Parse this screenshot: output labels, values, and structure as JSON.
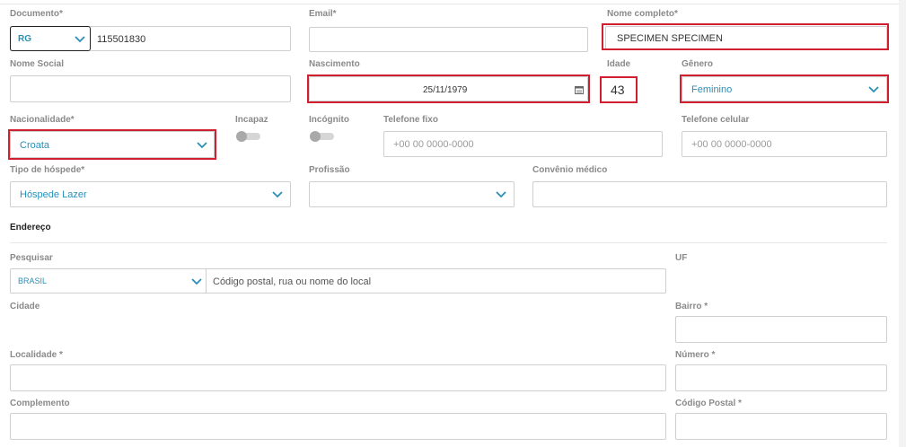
{
  "colors": {
    "accent": "#2a8fb6",
    "highlight": "#d01f2f",
    "border": "#cfcfcf",
    "label": "#8a8a8a"
  },
  "documento": {
    "label": "Documento*",
    "type": "RG",
    "number": "115501830"
  },
  "email": {
    "label": "Email*",
    "value": ""
  },
  "nome_completo": {
    "label": "Nome completo*",
    "value": "SPECIMEN SPECIMEN"
  },
  "nome_social": {
    "label": "Nome Social",
    "value": ""
  },
  "nascimento": {
    "label": "Nascimento",
    "value": "25/11/1979",
    "icon": "calendar-icon"
  },
  "idade": {
    "label": "Idade",
    "value": "43"
  },
  "genero": {
    "label": "Gênero",
    "value": "Feminino"
  },
  "nacionalidade": {
    "label": "Nacionalidade*",
    "value": "Croata"
  },
  "incapaz": {
    "label": "Incapaz",
    "on": false
  },
  "incognito": {
    "label": "Incógnito",
    "on": false
  },
  "telefone_fixo": {
    "label": "Telefone fixo",
    "placeholder": "+00 00 0000-0000"
  },
  "telefone_celular": {
    "label": "Telefone celular",
    "placeholder": "+00 00 0000-0000"
  },
  "tipo_hospede": {
    "label": "Tipo de hóspede*",
    "value": "Hóspede Lazer"
  },
  "profissao": {
    "label": "Profissão",
    "value": ""
  },
  "convenio": {
    "label": "Convênio médico",
    "value": ""
  },
  "endereco": {
    "section": "Endereço",
    "pesquisar": {
      "label": "Pesquisar",
      "country": "BRASIL",
      "placeholder": "Código postal, rua ou nome do local"
    },
    "uf": {
      "label": "UF"
    },
    "cidade": {
      "label": "Cidade"
    },
    "bairro": {
      "label": "Bairro *"
    },
    "localidade": {
      "label": "Localidade *"
    },
    "numero": {
      "label": "Número *"
    },
    "complemento": {
      "label": "Complemento"
    },
    "codigo_postal": {
      "label": "Código Postal *"
    }
  }
}
